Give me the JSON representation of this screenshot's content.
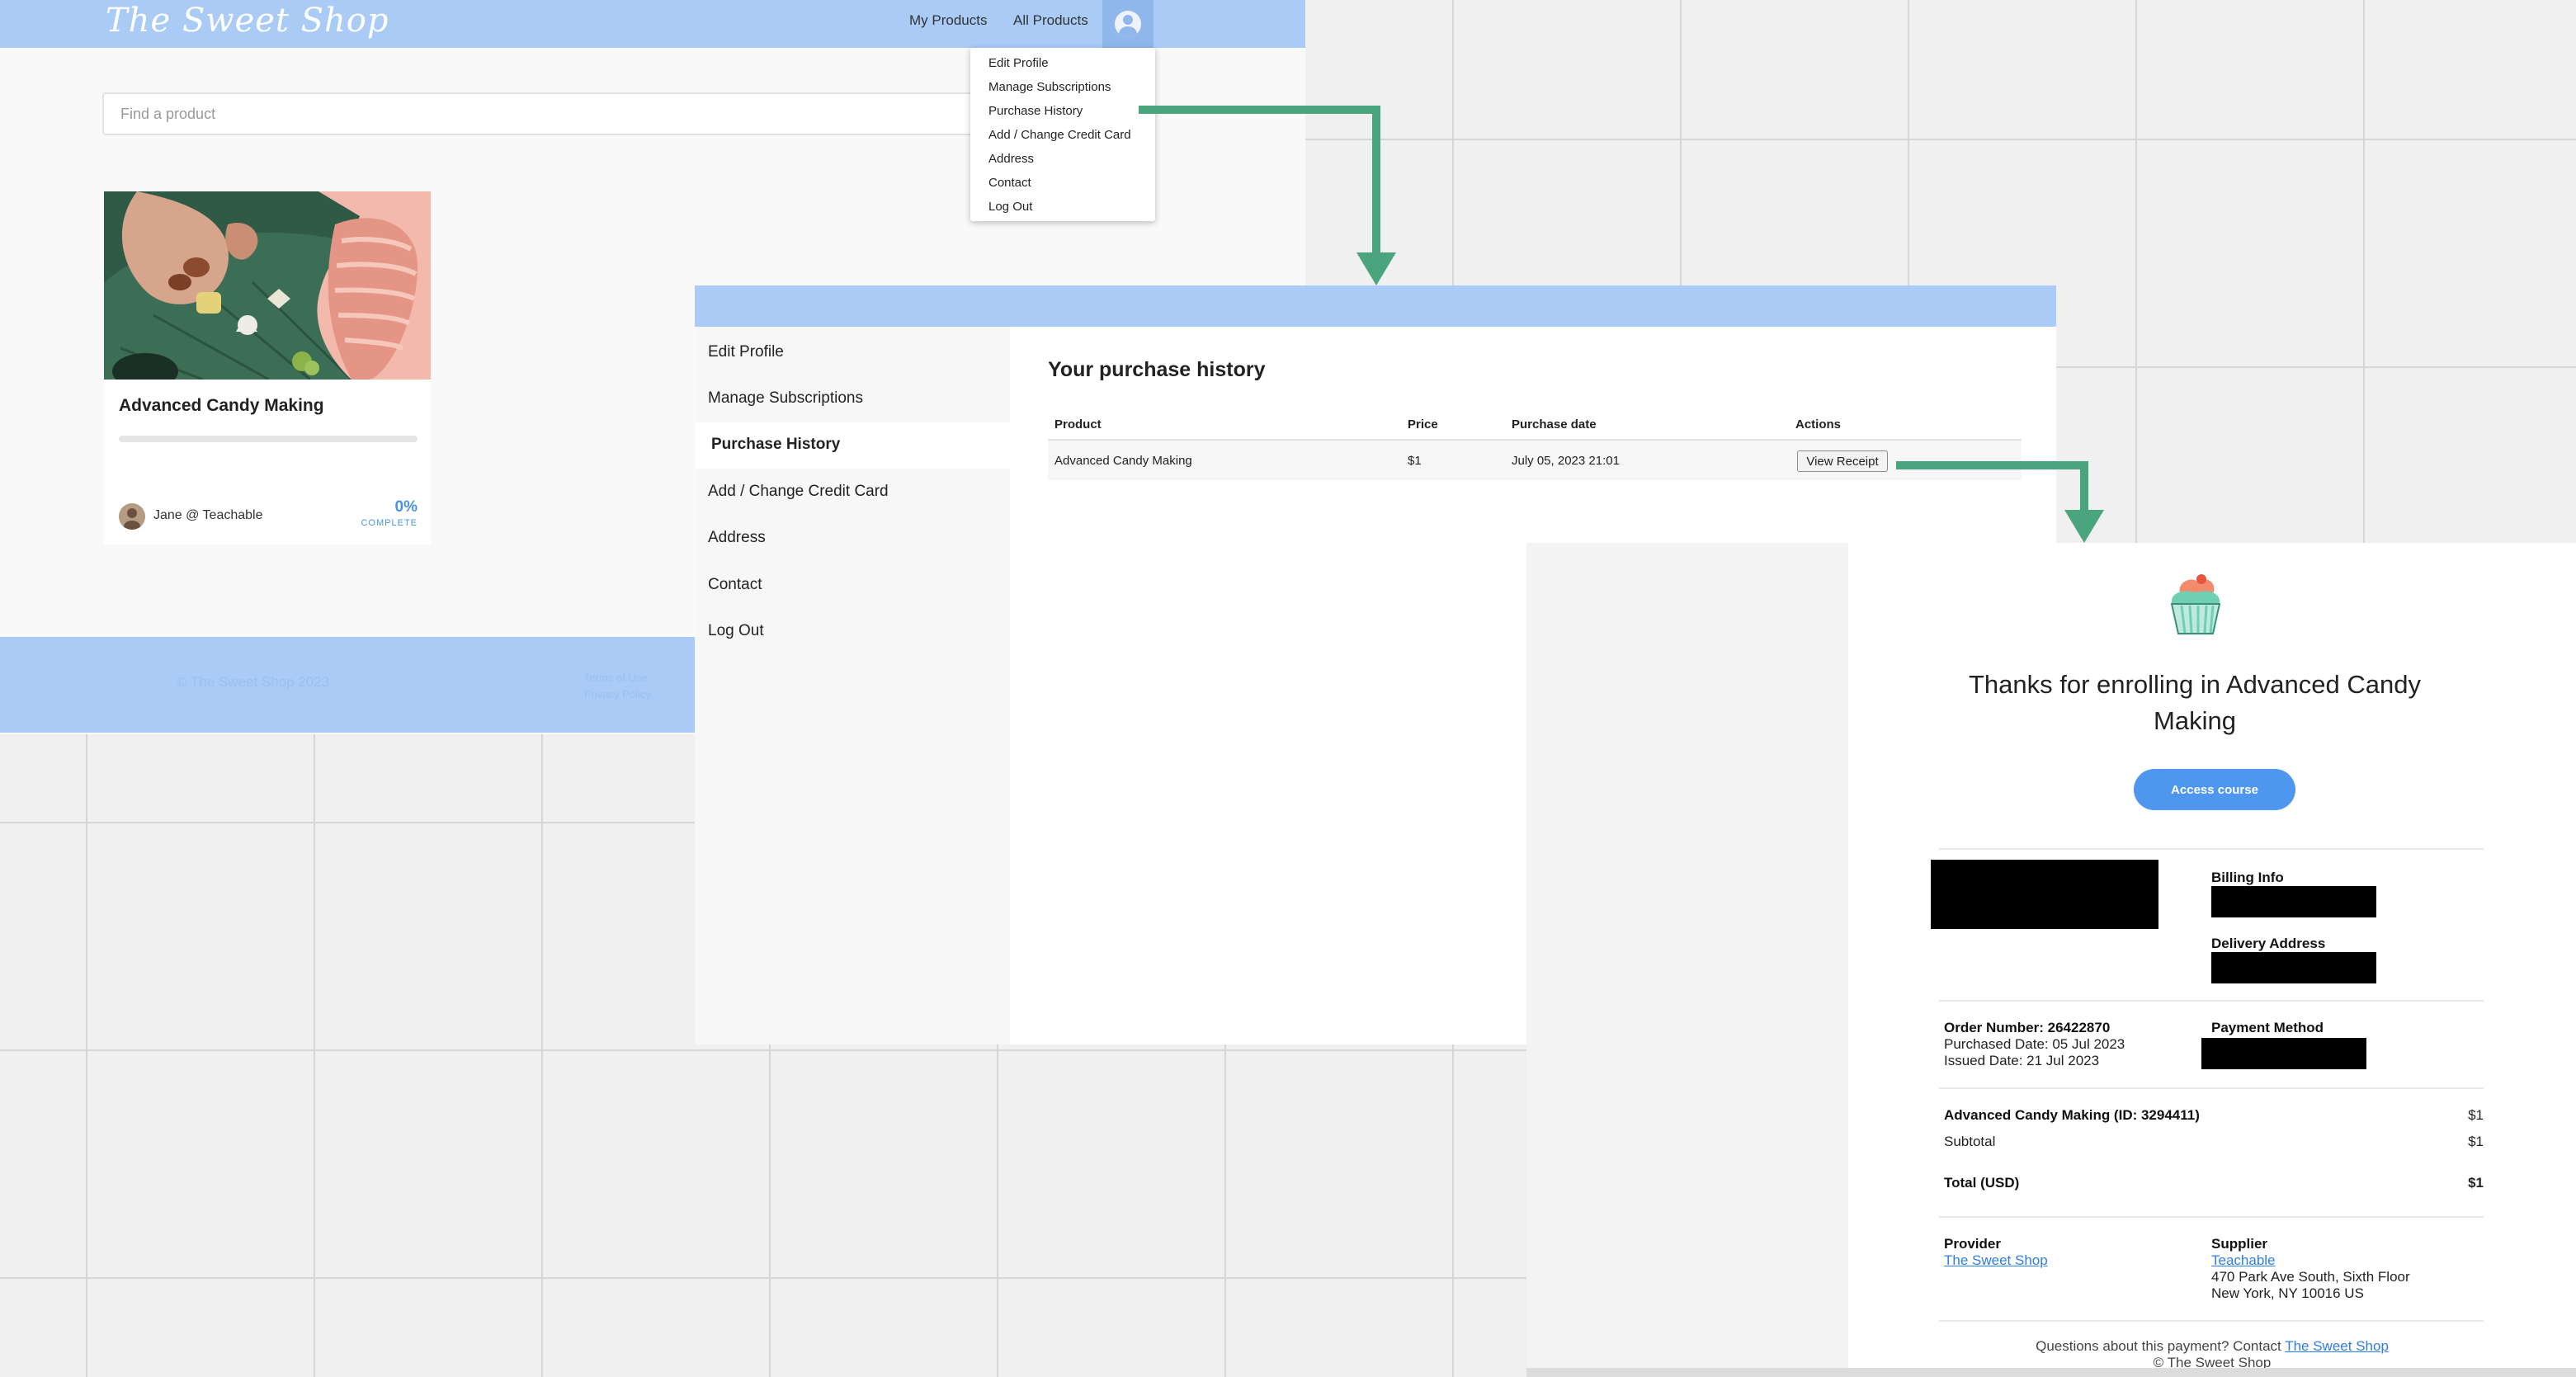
{
  "colors": {
    "header_blue": "#a9cbf6",
    "accent_blue": "#4e96ee",
    "arrow_green": "#4aa57e"
  },
  "store": {
    "logo_text": "The Sweet Shop",
    "nav": {
      "my_products": "My Products",
      "all_products": "All Products"
    },
    "avatar_icon": "user-avatar-icon",
    "dropdown_items": [
      "Edit Profile",
      "Manage Subscriptions",
      "Purchase History",
      "Add / Change Credit Card",
      "Address",
      "Contact",
      "Log Out"
    ],
    "search": {
      "placeholder": "Find a product"
    },
    "product_card": {
      "title": "Advanced Candy Making",
      "progress_percent": 0,
      "author": "Jane @ Teachable",
      "percent_label": "0%",
      "complete_label": "COMPLETE"
    },
    "footer": {
      "copyright": "© The Sweet Shop 2023",
      "terms": "Terms of Use",
      "privacy": "Privacy Policy"
    }
  },
  "account": {
    "sidebar_items": [
      "Edit Profile",
      "Manage Subscriptions",
      "Purchase History",
      "Add / Change Credit Card",
      "Address",
      "Contact",
      "Log Out"
    ],
    "active_item": "Purchase History",
    "history_title": "Your purchase history",
    "table": {
      "headers": {
        "product": "Product",
        "price": "Price",
        "date": "Purchase date",
        "actions": "Actions"
      },
      "rows": [
        {
          "product": "Advanced Candy Making",
          "price": "$1",
          "date": "July 05, 2023 21:01",
          "action": "View Receipt"
        }
      ]
    }
  },
  "receipt": {
    "logo_icon": "cupcake-icon",
    "thanks_line1": "Thanks for enrolling in Advanced Candy",
    "thanks_line2": "Making",
    "access_button": "Access course",
    "billing_label": "Billing Info",
    "delivery_label": "Delivery Address",
    "order_number_label": "Order Number: 26422870",
    "purchased_date": "Purchased Date: 05 Jul 2023",
    "issued_date": "Issued Date: 21 Jul 2023",
    "payment_method_label": "Payment Method",
    "line_item": "Advanced Candy Making (ID: 3294411)",
    "line_item_amount": "$1",
    "subtotal_label": "Subtotal",
    "subtotal_amount": "$1",
    "total_label": "Total (USD)",
    "total_amount": "$1",
    "provider_label": "Provider",
    "provider_link": "The Sweet Shop",
    "supplier_label": "Supplier",
    "supplier_link": "Teachable",
    "supplier_address1": "470 Park Ave South, Sixth Floor",
    "supplier_address2": "New York, NY 10016 US",
    "questions_text": "Questions about this payment? Contact",
    "questions_link": "The Sweet Shop",
    "copyright": "© The Sweet Shop"
  }
}
